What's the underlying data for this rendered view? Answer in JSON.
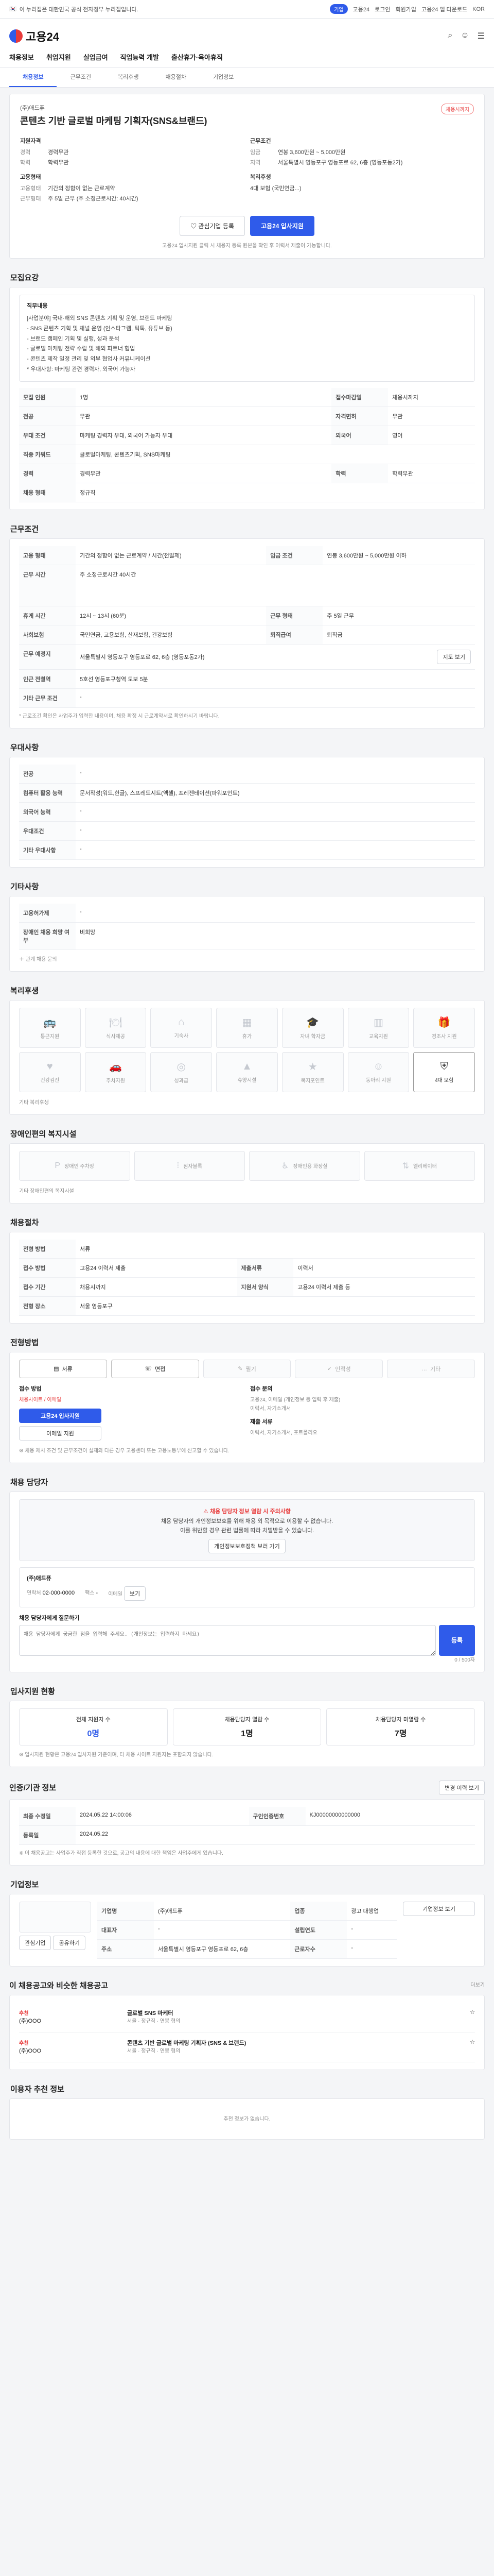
{
  "topbar": {
    "notice": "이 누리집은 대한민국 공식 전자정부 누리집입니다.",
    "links": [
      "고용24",
      "로그인",
      "회원가입"
    ],
    "app": "고용24 앱 다운로드",
    "lang": "KOR",
    "gov_pill": "기업"
  },
  "header": {
    "logo": "고용24",
    "gnb": [
      "채용정보",
      "취업지원",
      "실업급여",
      "직업능력 개발",
      "출산휴가·육아휴직"
    ]
  },
  "subtabs": [
    "채용정보",
    "근무조건",
    "복리후생",
    "채용절차",
    "기업정보"
  ],
  "job": {
    "company": "(주)애드퓨",
    "title": "콘텐츠 기반 글로벌 마케팅 기획자(SNS&브랜드)",
    "badge": "채용시까지",
    "summary_left_title": "지원자격",
    "summary_right_title": "근무조건",
    "left_rows": [
      {
        "k": "경력",
        "v": "경력무관"
      },
      {
        "k": "학력",
        "v": "학력무관"
      }
    ],
    "right_rows": [
      {
        "k": "임금",
        "v": "연봉 3,600만원 ~ 5,000만원"
      },
      {
        "k": "지역",
        "v": "서울특별시 영등포구 영등포로 62, 6층 (영등포동2가)"
      }
    ],
    "left_rows2_title": "고용형태",
    "left_rows2": [
      {
        "k": "고용형태",
        "v": "기간의 정함이 없는 근로계약"
      },
      {
        "k": "근무형태",
        "v": "주 5일 근무 (주 소정근로시간: 40시간)"
      }
    ],
    "right_rows2_title": "복리후생",
    "right_rows2": [
      {
        "k": "",
        "v": "4대 보험 (국민연금...)"
      }
    ],
    "btn_interest": "관심기업 등록",
    "btn_apply": "고용24 입사지원",
    "note": "고용24 입사지원 클릭 시 채용자 등록 원본을 확인 후 이력서 제출이 가능합니다."
  },
  "detail": {
    "section": "모집요강",
    "infobox_title": "직무내용",
    "infobox_lines": [
      "[사업분야] 국내·해외 SNS 콘텐츠 기획 및 운영, 브랜드 마케팅",
      "- SNS 콘텐츠 기획 및 채널 운영 (인스타그램, 틱톡, 유튜브 등)",
      "- 브랜드 캠페인 기획 및 실행, 성과 분석",
      "- 글로벌 마케팅 전략 수립 및 해외 파트너 협업",
      "- 콘텐츠 제작 일정 관리 및 외부 협업사 커뮤니케이션",
      "* 우대사항: 마케팅 관련 경력자, 외국어 가능자"
    ],
    "rows": [
      {
        "k": "모집 인원",
        "v": "1명",
        "k2": "접수마감일",
        "v2": "채용시까지"
      },
      {
        "k": "전공",
        "v": "무관",
        "k2": "자격면허",
        "v2": "무관"
      },
      {
        "k": "우대 조건",
        "v": "마케팅 경력자 우대, 외국어 가능자 우대",
        "k2": "외국어",
        "v2": "영어"
      },
      {
        "k": "직종 키워드",
        "v": "글로벌마케팅, 콘텐츠기획, SNS마케팅",
        "k2": "",
        "v2": ""
      },
      {
        "k": "경력",
        "v": "경력무관",
        "k2": "학력",
        "v2": "학력무관"
      },
      {
        "k": "채용 형태",
        "v": "정규직",
        "k2": "",
        "v2": ""
      }
    ]
  },
  "conditions": {
    "section": "근무조건",
    "rows": [
      {
        "k": "고용 형태",
        "v": "기간의 정함이 없는 근로계약 / 시간(전일제)",
        "k2": "임금 조건",
        "v2": "연봉 3,600만원 ~ 5,000만원 이하"
      },
      {
        "k": "근무 시간",
        "v": "주 소정근로시간 40시간",
        "k2": "",
        "v2": ""
      },
      {
        "k": "휴게 시간",
        "v": "12시 ~ 13시 (60분)",
        "k2": "근무 형태",
        "v2": "주 5일 근무"
      },
      {
        "k": "사회보험",
        "v": "국민연금, 고용보험, 산재보험, 건강보험",
        "k2": "퇴직급여",
        "v2": "퇴직금"
      },
      {
        "k": "근무 예정지",
        "v": "서울특별시 영등포구 영등포로 62, 6층 (영등포동2가)",
        "k2": "",
        "v2": ""
      },
      {
        "k": "인근 전철역",
        "v": "5호선 영등포구청역 도보 5분",
        "k2": "",
        "v2": ""
      },
      {
        "k": "기타 근무 조건",
        "v": "-",
        "k2": "",
        "v2": ""
      }
    ],
    "map_btn": "지도 보기",
    "note": "* 근로조건 확인은 사업주가 입력한 내용이며, 채용 확정 시 근로계약서로 확인하시기 바랍니다."
  },
  "prefer": {
    "section": "우대사항",
    "rows": [
      {
        "k": "전공",
        "v": "-"
      },
      {
        "k": "컴퓨터 활용 능력",
        "v": "문서작성(워드,한글), 스프레드시트(엑셀), 프레젠테이션(파워포인트)"
      },
      {
        "k": "외국어 능력",
        "v": "-"
      },
      {
        "k": "우대조건",
        "v": "-"
      },
      {
        "k": "기타 우대사항",
        "v": "-"
      }
    ]
  },
  "etc": {
    "section": "기타사항",
    "rows": [
      {
        "k": "고용허가제",
        "v": "-"
      },
      {
        "k": "장애인 채용 희망 여부",
        "v": "비희망"
      }
    ],
    "toggle": "관계 채용 문의"
  },
  "benefits": {
    "section": "복리후생",
    "items": [
      {
        "label": "통근지원",
        "icon": "bus-icon",
        "on": false
      },
      {
        "label": "식사제공",
        "icon": "meal-icon",
        "on": false
      },
      {
        "label": "기숙사",
        "icon": "house-icon",
        "on": false
      },
      {
        "label": "휴가",
        "icon": "calendar-icon",
        "on": false
      },
      {
        "label": "자녀 학자금",
        "icon": "grad-icon",
        "on": false
      },
      {
        "label": "교육지원",
        "icon": "book-icon",
        "on": false
      },
      {
        "label": "경조사 지원",
        "icon": "gift-icon",
        "on": false
      },
      {
        "label": "건강검진",
        "icon": "heart-icon",
        "on": false
      },
      {
        "label": "주차지원",
        "icon": "car-icon",
        "on": false
      },
      {
        "label": "성과급",
        "icon": "coin-icon",
        "on": false
      },
      {
        "label": "휴양시설",
        "icon": "mountain-icon",
        "on": false
      },
      {
        "label": "복지포인트",
        "icon": "star-icon",
        "on": false
      },
      {
        "label": "동아리 지원",
        "icon": "people-icon",
        "on": false
      },
      {
        "label": "4대 보험",
        "icon": "shield-icon",
        "on": true
      }
    ],
    "etc": "기타 복리후생"
  },
  "disability": {
    "section": "장애인편의 복지시설",
    "items": [
      "장애인 주차장",
      "점자블록",
      "장애인용 화장실",
      "엘리베이터"
    ],
    "etc": "기타 장애인편의 복지시설"
  },
  "process": {
    "section": "채용절차",
    "rows": [
      {
        "k": "전형 방법",
        "v": "서류",
        "k2": "",
        "v2": ""
      },
      {
        "k": "접수 방법",
        "v": "고용24 이력서 제출",
        "k2": "제출서류",
        "v2": "이력서"
      },
      {
        "k": "접수 기간",
        "v": "채용시까지",
        "k2": "지원서 양식",
        "v2": "고용24 이력서 제출 등"
      },
      {
        "k": "전형 장소",
        "v": "서울 영등포구",
        "k2": "",
        "v2": ""
      }
    ]
  },
  "apply": {
    "section": "전형방법",
    "methods": [
      {
        "label": "서류",
        "on": true
      },
      {
        "label": "면접",
        "on": true
      },
      {
        "label": "필기",
        "on": false
      },
      {
        "label": "인적성",
        "on": false
      },
      {
        "label": "기타",
        "on": false
      }
    ],
    "left_title": "접수 방법",
    "left_line1": "채용사이트 / 이메일",
    "btn_apply": "고용24 입사지원",
    "btn_email": "이메일 지원",
    "right_title": "접수 문의",
    "right_lines": [
      "고용24, 이메일 (개인정보 등 입력 후 제출)",
      "이력서, 자기소개서"
    ],
    "right_sub_title": "제출 서류",
    "right_sub": "이력서, 자기소개서, 포트폴리오",
    "note": "※ 채용 제시 조건 및 근무조건이 실제와 다른 경우 고용센터 또는 고용노동부에 신고할 수 있습니다."
  },
  "contact": {
    "section": "채용 담당자",
    "alert_warn": "채용 담당자 정보 열람 시 주의사항",
    "alert_lines": [
      "채용 담당자의 개인정보보호를 위해 채용 외 목적으로 이용할 수 없습니다.",
      "이를 위반할 경우 관련 법률에 따라 처벌받을 수 있습니다."
    ],
    "alert_btn": "개인정보보호정책 보러 가기",
    "company": "(주)애드퓨",
    "phone_label": "연락처",
    "phone": "02-000-0000",
    "fax_label": "팩스",
    "fax": "-",
    "email_label": "이메일",
    "email_btn": "보기",
    "q_title": "채용 담당자에게 질문하기",
    "q_placeholder": "채용 담당자에게 궁금한 점을 입력해 주세요. (개인정보는 입력하지 마세요)",
    "q_btn": "등록",
    "q_count": "0 / 500자"
  },
  "stats": {
    "section": "입사지원 현황",
    "total": "지원자 수",
    "total_v": "0명",
    "items": [
      {
        "label": "전체 지원자 수",
        "v": "0명"
      },
      {
        "label": "채용담당자 열람 수",
        "v": "1명"
      },
      {
        "label": "채용담당자 미열람 수",
        "v": "7명"
      }
    ],
    "note": "※ 입사지원 현황은 고용24 입사지원 기준이며, 타 채용 사이트 지원자는 포함되지 않습니다."
  },
  "reg": {
    "section": "인증/기관 정보",
    "btn_history": "변경 이력 보기",
    "rows": [
      {
        "k": "최종 수정일",
        "v": "2024.05.22 14:00:06",
        "k2": "구인인증번호",
        "v2": "KJ00000000000000"
      },
      {
        "k": "등록일",
        "v": "2024.05.22",
        "k2": "",
        "v2": ""
      }
    ],
    "note": "※ 이 채용공고는 사업주가 직접 등록한 것으로, 공고의 내용에 대한 책임은 사업주에게 있습니다."
  },
  "company_info": {
    "section": "기업정보",
    "rows": [
      {
        "k": "기업명",
        "v": "(주)애드퓨",
        "k2": "업종",
        "v2": "광고 대행업"
      },
      {
        "k": "대표자",
        "v": "-",
        "k2": "설립연도",
        "v2": "-"
      },
      {
        "k": "주소",
        "v": "서울특별시 영등포구 영등포로 62, 6층",
        "k2": "근로자수",
        "v2": "-"
      }
    ],
    "btn_detail": "기업정보 보기",
    "btn_like": "관심기업",
    "btn_share": "공유하기"
  },
  "related": {
    "section": "이 채용공고와 비슷한 채용공고",
    "more": "더보기",
    "items": [
      {
        "tag": "추천",
        "company": "(주)OOO",
        "title": "글로벌 SNS 마케터",
        "loc": "서울",
        "emp": "정규직",
        "sal": "연봉 협의"
      },
      {
        "tag": "추천",
        "company": "(주)OOO",
        "title": "콘텐츠 기반 글로벌 마케팅 기획자 (SNS & 브랜드)",
        "loc": "서울",
        "emp": "정규직",
        "sal": "연봉 협의"
      }
    ]
  },
  "footer": {
    "section": "이용자 추천 정보",
    "empty": "추천 정보가 없습니다."
  }
}
